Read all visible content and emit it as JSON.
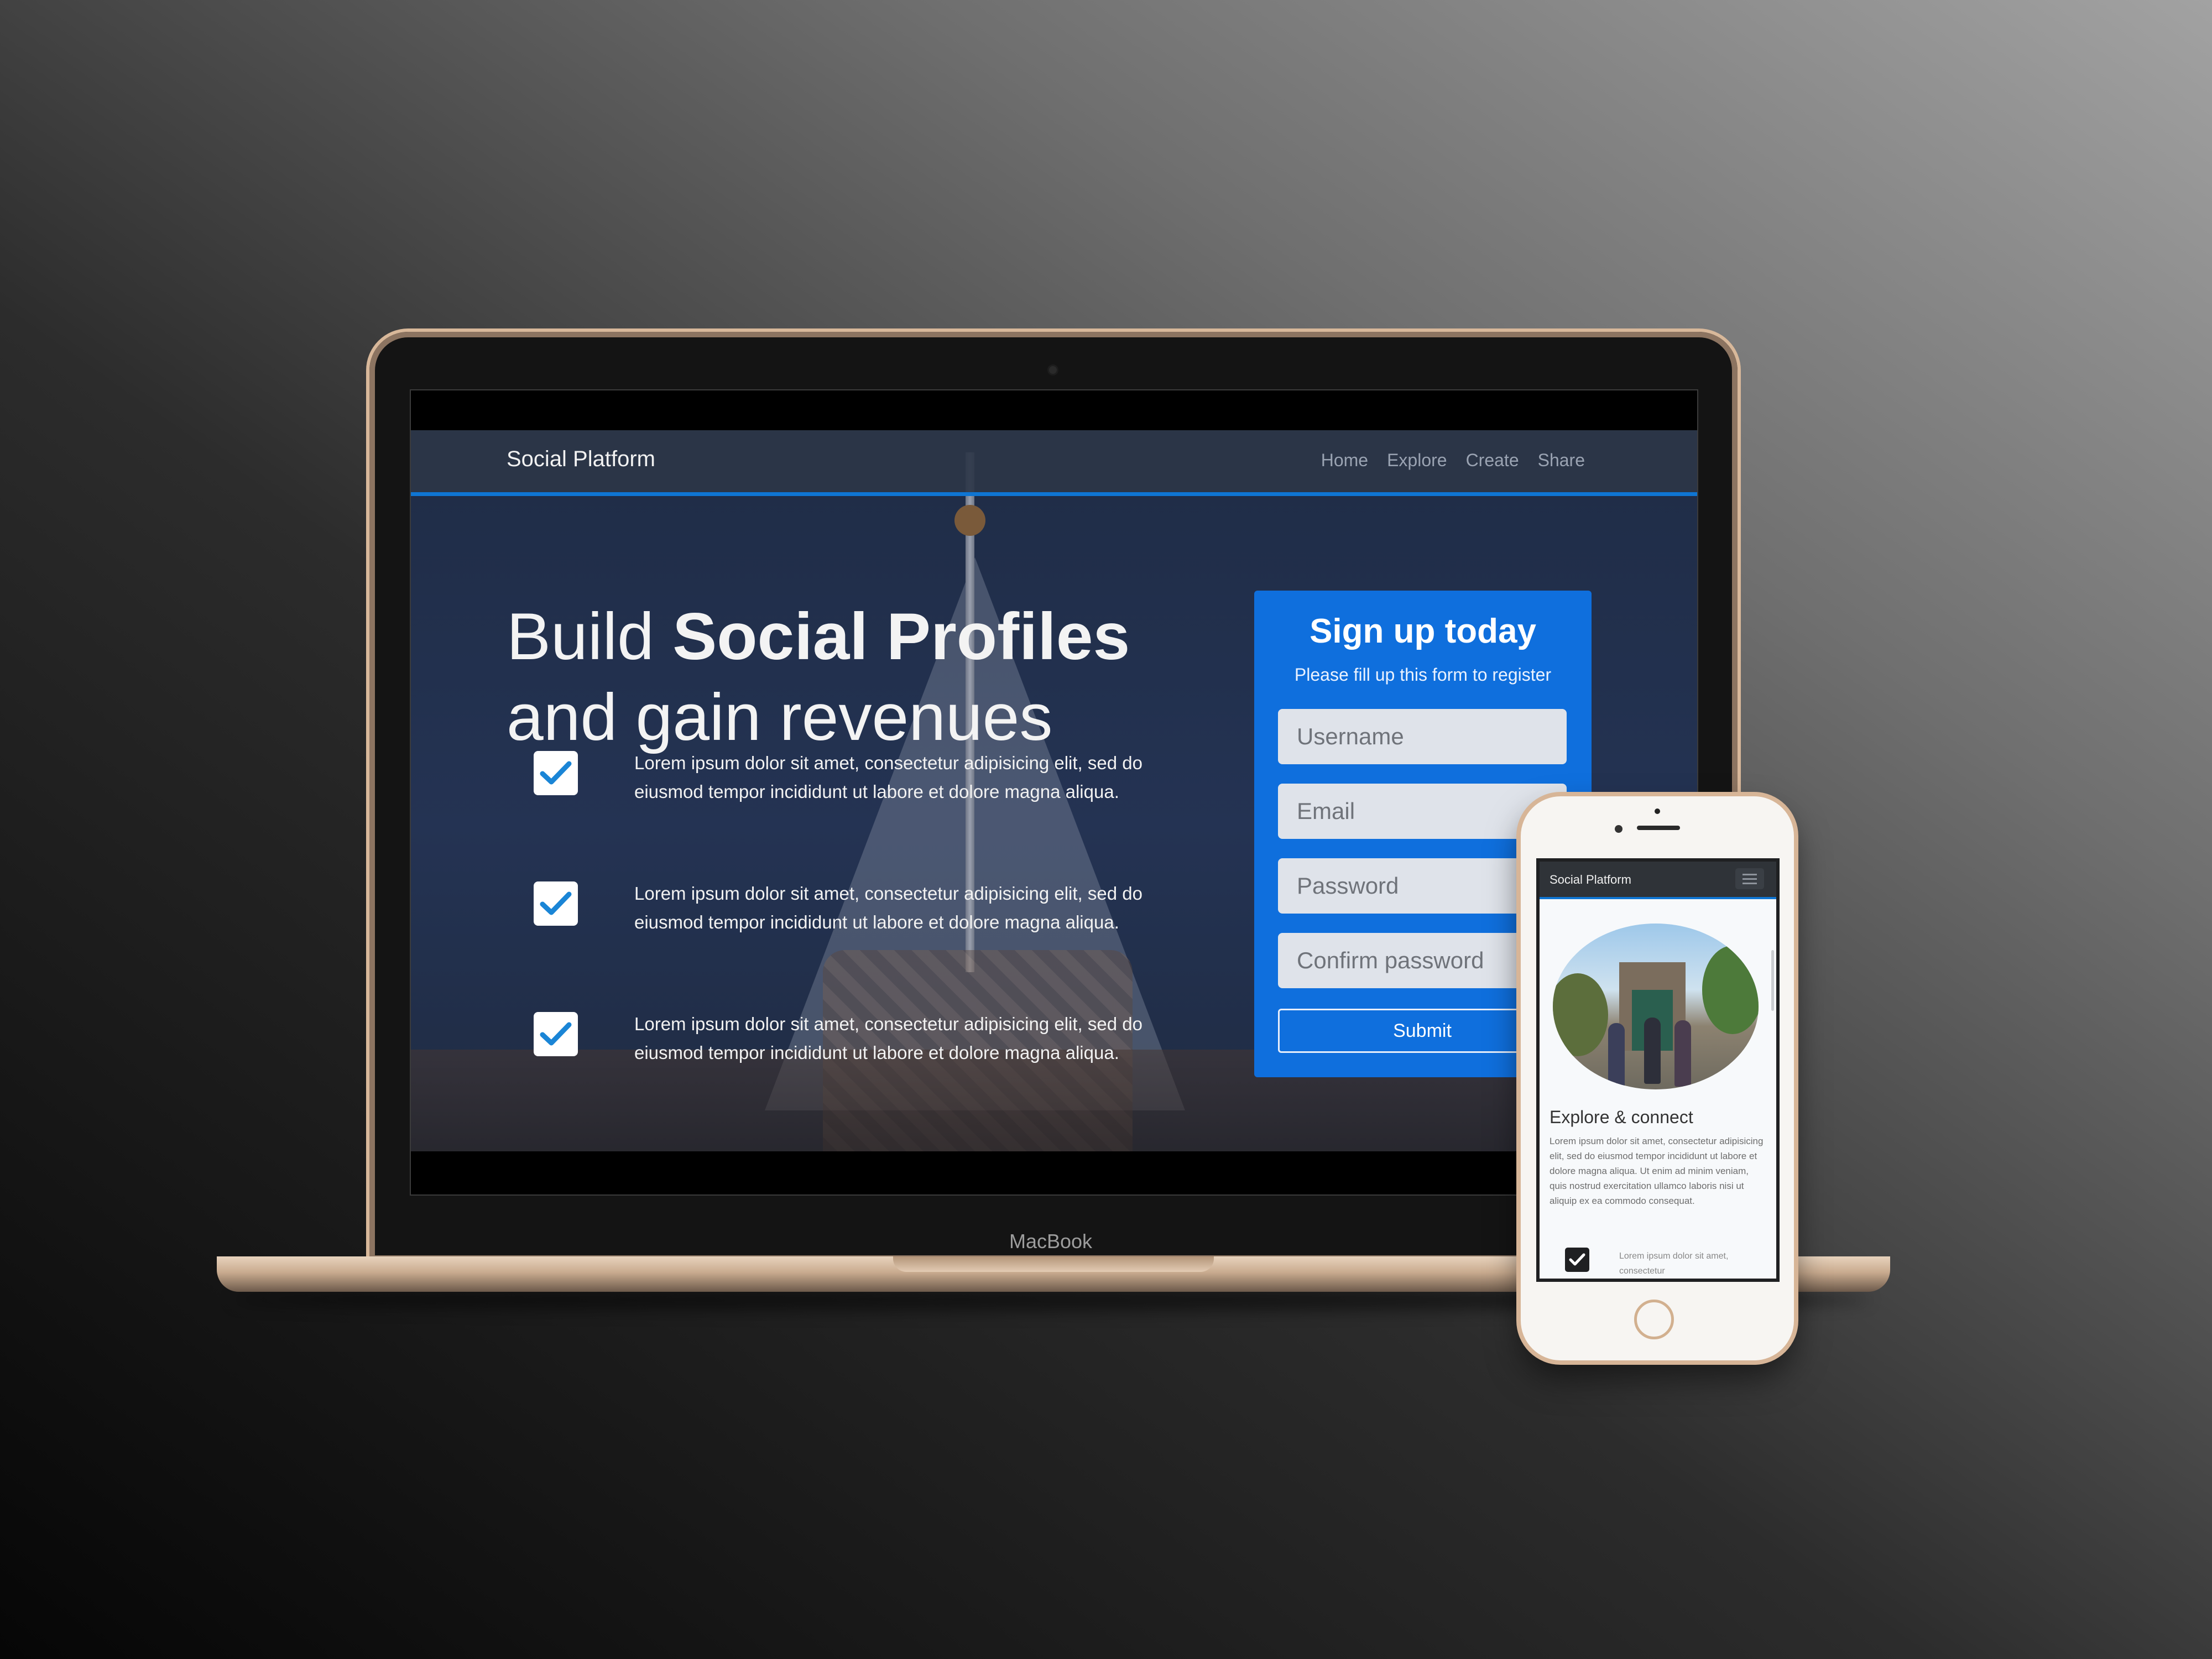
{
  "laptop": {
    "brand_label": "MacBook",
    "site": {
      "navbar": {
        "brand": "Social Platform",
        "links": [
          "Home",
          "Explore",
          "Create",
          "Share"
        ]
      },
      "hero": {
        "title_pre": "Build ",
        "title_bold": "Social Profiles",
        "title_post": " and gain revenues"
      },
      "features": [
        {
          "text": "Lorem ipsum dolor sit amet, consectetur adipisicing elit, sed do eiusmod tempor incididunt ut labore et dolore magna aliqua."
        },
        {
          "text": "Lorem ipsum dolor sit amet, consectetur adipisicing elit, sed do eiusmod tempor incididunt ut labore et dolore magna aliqua."
        },
        {
          "text": "Lorem ipsum dolor sit amet, consectetur adipisicing elit, sed do eiusmod tempor incididunt ut labore et dolore magna aliqua."
        }
      ],
      "signup": {
        "title": "Sign up today",
        "subtitle": "Please fill up this form to register",
        "fields": {
          "username": "Username",
          "email": "Email",
          "password": "Password",
          "confirm": "Confirm password"
        },
        "submit": "Submit"
      }
    }
  },
  "phone": {
    "navbar": {
      "brand": "Social Platform",
      "menu_icon": "hamburger-icon"
    },
    "section": {
      "heading": "Explore & connect",
      "paragraph": "Lorem ipsum dolor sit amet, consectetur adipisicing elit, sed do eiusmod tempor incididunt ut labore et dolore magna aliqua. Ut enim ad minim veniam, quis nostrud exercitation ullamco laboris nisi ut aliquip ex ea commodo consequat.",
      "feature_text": "Lorem ipsum dolor sit amet, consectetur"
    }
  },
  "colors": {
    "accent": "#0f6fdd",
    "nav_border": "#0f75d3",
    "check": "#1a85d6"
  }
}
